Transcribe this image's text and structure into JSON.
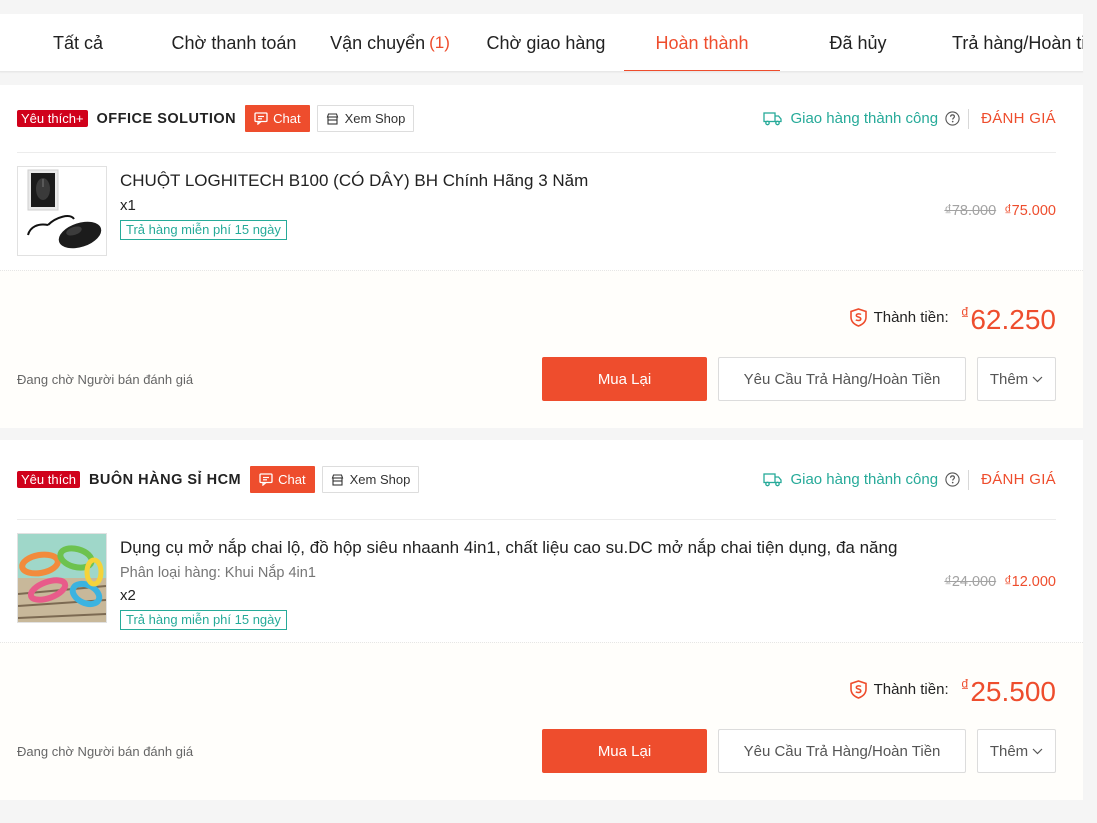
{
  "tabs": [
    {
      "label": "Tất cả"
    },
    {
      "label": "Chờ thanh toán"
    },
    {
      "label": "Vận chuyển",
      "count": "(1)"
    },
    {
      "label": "Chờ giao hàng"
    },
    {
      "label": "Hoàn thành",
      "active": true
    },
    {
      "label": "Đã hủy"
    },
    {
      "label": "Trả hàng/Hoàn tiền"
    }
  ],
  "colors": {
    "brand": "#ee4d2d",
    "success": "#26aa99",
    "favorite_badge": "#d0011b"
  },
  "orders": [
    {
      "favorite_label": "Yêu thích+",
      "shop_name": "OFFICE SOLUTION",
      "chat_label": "Chat",
      "view_shop_label": "Xem Shop",
      "status": "Giao hàng thành công",
      "rate_label": "ĐÁNH GIÁ",
      "product": {
        "name": "CHUỘT LOGHITECH B100 (CÓ DÂY) BH Chính Hãng 3 Năm",
        "variant": "",
        "qty": "x1",
        "free_return": "Trả hàng miễn phí 15 ngày",
        "old_price": "₫78.000",
        "new_price": "₫75.000"
      },
      "total_label": "Thành tiền:",
      "total_currency": "₫",
      "total_amount": "62.250",
      "waiting_text": "Đang chờ Người bán đánh giá",
      "buy_again_label": "Mua Lại",
      "refund_label": "Yêu Cầu Trả Hàng/Hoàn Tiền",
      "more_label": "Thêm"
    },
    {
      "favorite_label": "Yêu thích",
      "shop_name": "BUÔN HÀNG SỈ HCM",
      "chat_label": "Chat",
      "view_shop_label": "Xem Shop",
      "status": "Giao hàng thành công",
      "rate_label": "ĐÁNH GIÁ",
      "product": {
        "name": "Dụng cụ mở nắp chai lộ, đồ hộp siêu nhaanh 4in1, chất liệu cao su.DC mở nắp chai tiện dụng, đa năng",
        "variant": "Phân loại hàng: Khui Nắp 4in1",
        "qty": "x2",
        "free_return": "Trả hàng miễn phí 15 ngày",
        "old_price": "₫24.000",
        "new_price": "₫12.000"
      },
      "total_label": "Thành tiền:",
      "total_currency": "₫",
      "total_amount": "25.500",
      "waiting_text": "Đang chờ Người bán đánh giá",
      "buy_again_label": "Mua Lại",
      "refund_label": "Yêu Cầu Trả Hàng/Hoàn Tiền",
      "more_label": "Thêm"
    }
  ]
}
